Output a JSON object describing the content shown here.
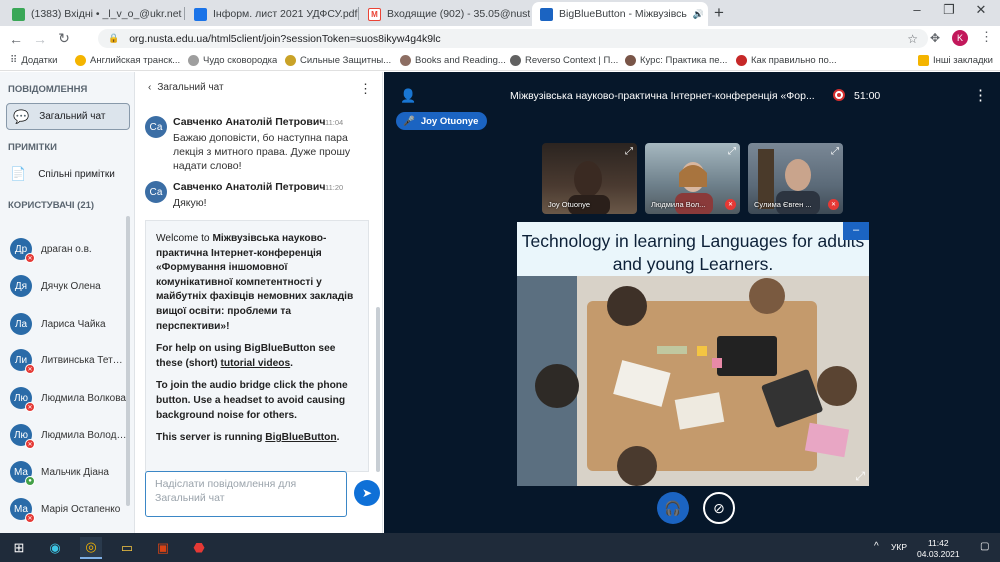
{
  "tabs": [
    {
      "title": "(1383) Вхідні • _l_v_o_@ukr.net",
      "favicon": "ukr-net-icon",
      "color": "#3aa757"
    },
    {
      "title": "Інформ. лист 2021 УДФСУ.pdf",
      "favicon": "google-drive-icon",
      "color": "#1a73e8"
    },
    {
      "title": "Входящие (902) - 35.05@nusta.e",
      "favicon": "gmail-icon",
      "color": "#ea4335"
    },
    {
      "title": "BigBlueButton - Міжвузівсь",
      "favicon": "bigbluebutton-icon",
      "color": "#1b64c2"
    }
  ],
  "address": {
    "url": "org.nusta.edu.ua/html5client/join?sessionToken=suos8ikyw4g4k9lc"
  },
  "profile_initial": "K",
  "bookmarks": [
    {
      "label": "Додатки",
      "color": "#5f6368"
    },
    {
      "label": "Английская транск...",
      "color": "#f4b400"
    },
    {
      "label": "Чудо сковородка",
      "color": "#9e9e9e"
    },
    {
      "label": "Сильные Защитны...",
      "color": "#c9a227"
    },
    {
      "label": "Books and Reading...",
      "color": "#8d6e63"
    },
    {
      "label": "Reverso Context | П...",
      "color": "#616161"
    },
    {
      "label": "Курс: Практика пе...",
      "color": "#795548"
    },
    {
      "label": "Как правильно по...",
      "color": "#c62828"
    },
    {
      "label": "Інші закладки",
      "color": "#f4b400"
    }
  ],
  "sidebar": {
    "messages_header": "ПОВІДОМЛЕННЯ",
    "public_chat": "Загальний чат",
    "notes_header": "ПРИМІТКИ",
    "shared_notes": "Спільні примітки",
    "users_header": "КОРИСТУВАЧІ (21)",
    "users": [
      {
        "initials": "Др",
        "name": "драган о.в."
      },
      {
        "initials": "Дя",
        "name": "Дячук Олена"
      },
      {
        "initials": "Ла",
        "name": "Лариса Чайка"
      },
      {
        "initials": "Ли",
        "name": "Литвинська Тетян..."
      },
      {
        "initials": "Лю",
        "name": "Людмила Волкова"
      },
      {
        "initials": "Лю",
        "name": "Людмила Володи..."
      },
      {
        "initials": "Ма",
        "name": "Мальчик Діана"
      },
      {
        "initials": "Ма",
        "name": "Марія Остапенко"
      }
    ]
  },
  "chat": {
    "header": "Загальний чат",
    "messages": [
      {
        "initials": "Са",
        "sender": "Савченко Анатолій Петрович",
        "time": "11:04",
        "text": "Бажаю доповісти, бо наступна пара лекція з митного права. Дуже прошу надати слово!"
      },
      {
        "initials": "Са",
        "sender": "Савченко Анатолій Петрович",
        "time": "11:20",
        "text": "Дякую!"
      }
    ],
    "welcome": {
      "prefix": "Welcome to ",
      "name": "Міжвузівська науково-практична Інтернет-конференція «Формування іншомовної комунікативної компетентності у майбутніх фахівців немовних закладів вищої освіти: проблеми та перспективи»",
      "suffix": "!",
      "help1": "For help on using BigBlueButton see these (short) ",
      "help_link": "tutorial videos",
      "help2": ".",
      "audio": "To join the audio bridge click the phone button. Use a headset to avoid causing background noise for others.",
      "server1": "This server is running ",
      "server_link": "BigBlueButton",
      "server2": "."
    },
    "input_placeholder": "Надіслати повідомлення для Загальний чат"
  },
  "meeting": {
    "title": "Міжвузівська науково-практична Інтернет-конференція «Фор...",
    "recording_time": "51:00",
    "talking": "Joy Otuonye",
    "videos": [
      {
        "name": "Joy Otuonye",
        "bg": "#4a3a30"
      },
      {
        "name": "Людмила Вол...",
        "bg": "#6d7f8a"
      },
      {
        "name": "Сулима Євген ...",
        "bg": "#5b6a78"
      }
    ],
    "slide_title": "Technology in learning Languages for adults and young Learners."
  },
  "taskbar": {
    "lang": "УКР",
    "time": "11:42",
    "date": "04.03.2021"
  }
}
